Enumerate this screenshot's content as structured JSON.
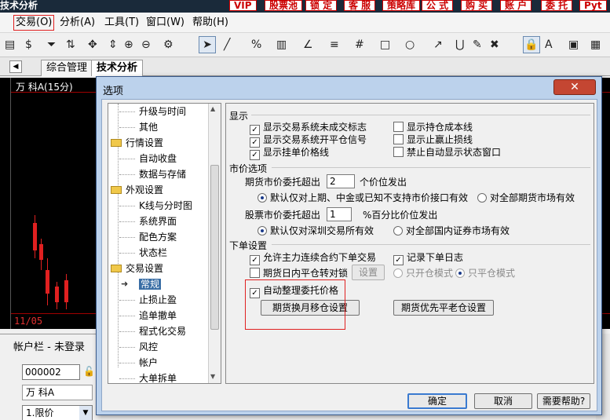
{
  "app": {
    "title": "技术分析",
    "title_buttons": [
      "VIP",
      "股票池",
      "锁 定",
      "客 服",
      "策略库",
      "公 式",
      "购 买",
      "账 户",
      "委 托",
      "Pyt"
    ]
  },
  "menu": [
    "交易(O)",
    "分析(A)",
    "工具(T)",
    "窗口(W)",
    "帮助(H)"
  ],
  "tabs": [
    "综合管理",
    "技术分析"
  ],
  "chart": {
    "stock": "万 科A(15分)",
    "date": "11/05"
  },
  "account": {
    "title": "帐户栏 - 未登录",
    "account_id": "000002",
    "stock": "万 科A",
    "order_type": "1.限价"
  },
  "dialog": {
    "title": "选项",
    "close_label": "✕",
    "ok": "确定",
    "cancel": "取消",
    "help": "需要帮助?"
  },
  "tree": {
    "items": [
      {
        "label": "升级与时间",
        "level": 1
      },
      {
        "label": "其他",
        "level": 1
      },
      {
        "label": "行情设置",
        "level": 0
      },
      {
        "label": "自动收盘",
        "level": 1
      },
      {
        "label": "数据与存储",
        "level": 1
      },
      {
        "label": "外观设置",
        "level": 0
      },
      {
        "label": "K线与分时图",
        "level": 1
      },
      {
        "label": "系统界面",
        "level": 1
      },
      {
        "label": "配色方案",
        "level": 1
      },
      {
        "label": "状态栏",
        "level": 1
      },
      {
        "label": "交易设置",
        "level": 0
      },
      {
        "label": "常规",
        "level": 1,
        "selected": true
      },
      {
        "label": "止损止盈",
        "level": 1
      },
      {
        "label": "追单撤单",
        "level": 1
      },
      {
        "label": "程式化交易",
        "level": 1
      },
      {
        "label": "风控",
        "level": 1
      },
      {
        "label": "帐户",
        "level": 1
      },
      {
        "label": "大单拆单",
        "level": 1
      }
    ]
  },
  "display": {
    "title": "显示",
    "show_unfilled": "显示交易系统未成交标志",
    "show_open_close": "显示交易系统开平仓信号",
    "show_pending_price": "显示挂单价格线",
    "show_cost_line": "显示持仓成本线",
    "show_stop_line": "显示止赢止损线",
    "disable_status": "禁止自动显示状态窗口"
  },
  "market_order": {
    "title": "市价选项",
    "futures_label": "期货市价委托超出",
    "futures_value": "2",
    "futures_suffix": "个价位发出",
    "futures_opt1": "默认仅对上期、中金或已知不支持市价接口有效",
    "futures_opt2": "对全部期货市场有效",
    "stock_label": "股票市价委托超出",
    "stock_value": "1",
    "stock_suffix": "%百分比价位发出",
    "stock_opt1": "默认仅对深圳交易所有效",
    "stock_opt2": "对全部国内证券市场有效"
  },
  "order_settings": {
    "title": "下单设置",
    "allow_continuous": "允许主力连续合约下单交易",
    "record_log": "记录下单日志",
    "intraday_lock": "期货日内平仓转对锁",
    "setup_btn": "设置",
    "close_only": "只开仓模式",
    "close_only_alt": "只平仓模式",
    "auto_arrange": "自动整理委托价格",
    "monthly_btn": "期货换月移仓设置",
    "priority_btn": "期货优先平老仓设置"
  }
}
